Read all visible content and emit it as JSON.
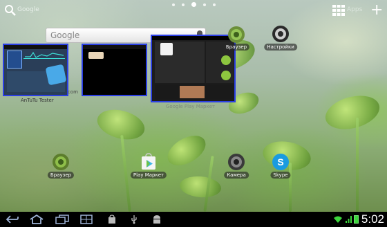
{
  "top_bar": {
    "search_label": "Google",
    "apps_label": "Apps",
    "add_symbol": "+",
    "page_dots": 5,
    "active_page": 3
  },
  "search_widget": {
    "placeholder": "Google"
  },
  "thumbnails": {
    "antutu_caption": "AnTuTu Tester",
    "url_fragment": "com",
    "play_caption": "Google Play Маркет"
  },
  "home_icons": {
    "browser_top": "Браузер",
    "settings": "Настройки",
    "browser_bottom": "Браузер",
    "play_market": "Play Маркет",
    "camera": "Камера",
    "skype": "Skype"
  },
  "status_bar": {
    "time": "5:02"
  },
  "colors": {
    "thumb_border": "#2b3fe4",
    "battery": "#3cd63c"
  }
}
